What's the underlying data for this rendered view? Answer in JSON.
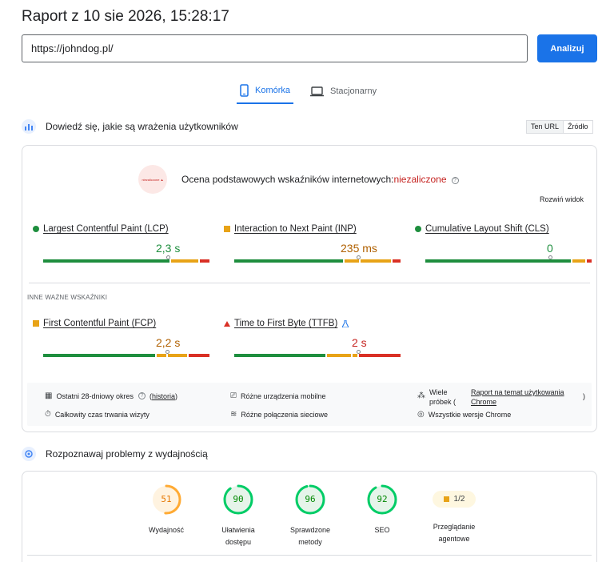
{
  "header": {
    "title": "Raport z 10 sie 2026, 15:28:17"
  },
  "search": {
    "url_value": "https://johndog.pl/",
    "analyze_label": "Analizuj"
  },
  "tabs": [
    {
      "label": "Komórka",
      "active": true,
      "icon": "phone-icon"
    },
    {
      "label": "Stacjonarny",
      "active": false,
      "icon": "laptop-icon"
    }
  ],
  "cwv_section": {
    "heading": "Dowiedź się, jakie są wrażenia użytkowników",
    "toggle": {
      "this_url": "Ten URL",
      "origin": "Źródło"
    },
    "assessment": {
      "badge_text": "niezaliczone ▲",
      "label": "Ocena podstawowych wskaźników internetowych:",
      "status": "niezaliczone",
      "status_color": "#c5221f"
    },
    "expand_label": "Rozwiń widok",
    "core_metrics": [
      {
        "name": "Largest Contentful Paint (LCP)",
        "value": "2,3 s",
        "status": "good",
        "color": "#1e8e3e",
        "marker_fraction": 0.75
      },
      {
        "name": "Interaction to Next Paint (INP)",
        "value": "235 ms",
        "status": "needs-improvement",
        "color": "#b06000",
        "marker_fraction": 0.66
      },
      {
        "name": "Cumulative Layout Shift (CLS)",
        "value": "0",
        "status": "good",
        "color": "#1e8e3e",
        "marker_fraction": 0.75
      }
    ],
    "other_label": "INNE WAŻNE WSKAŹNIKI",
    "other_metrics": [
      {
        "name": "First Contentful Paint (FCP)",
        "value": "2,2 s",
        "status": "needs-improvement",
        "color": "#b06000",
        "marker_fraction": 0.75
      },
      {
        "name": "Time to First Byte (TTFB)",
        "value": "2 s",
        "status": "poor",
        "color": "#c5221f",
        "marker_fraction": 0.75
      }
    ],
    "info": {
      "period": "Ostatni 28-dniowy okres",
      "history": "historia",
      "devices": "Różne urządzenia mobilne",
      "samples_prefix": "Wiele próbek (",
      "samples_link": "Raport na temat użytkowania Chrome",
      "samples_suffix": ")",
      "duration": "Całkowity czas trwania wizyty",
      "network": "Różne połączenia sieciowe",
      "chrome": "Wszystkie wersje Chrome"
    }
  },
  "perf_section": {
    "heading": "Rozpoznawaj problemy z wydajnością",
    "scores": [
      {
        "value": "51",
        "label": "Wydajność",
        "fraction": 0.51,
        "color": "#e67700",
        "ring": "#fa3",
        "bg": "#fff3e0"
      },
      {
        "value": "90",
        "label": "Ułatwienia dostępu",
        "fraction": 0.9,
        "color": "#008800",
        "ring": "#0c6",
        "bg": "#e6f4ea"
      },
      {
        "value": "96",
        "label": "Sprawdzone metody",
        "fraction": 0.96,
        "color": "#008800",
        "ring": "#0c6",
        "bg": "#e6f4ea"
      },
      {
        "value": "92",
        "label": "SEO",
        "fraction": 0.92,
        "color": "#008800",
        "ring": "#0c6",
        "bg": "#e6f4ea"
      }
    ],
    "agentic": {
      "value": "1/2",
      "label": "Przeglądanie agentowe"
    }
  }
}
